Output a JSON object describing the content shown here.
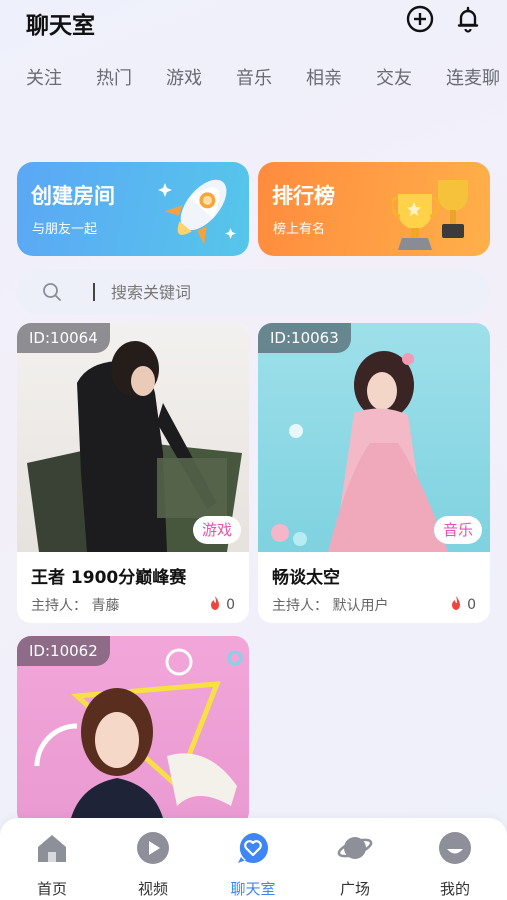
{
  "header": {
    "title": "聊天室"
  },
  "tabs": [
    "关注",
    "热门",
    "游戏",
    "音乐",
    "相亲",
    "交友",
    "连麦聊"
  ],
  "banners": {
    "create": {
      "title": "创建房间",
      "subtitle": "与朋友一起"
    },
    "rank": {
      "title": "排行榜",
      "subtitle": "榜上有名"
    }
  },
  "search": {
    "placeholder": "搜索关键词"
  },
  "rooms": [
    {
      "id": "ID:10064",
      "name": "王者 1900分巅峰赛",
      "host": "主持人：  青藤",
      "heat": "0",
      "category": "游戏"
    },
    {
      "id": "ID:10063",
      "name": "畅谈太空",
      "host": "主持人：  默认用户",
      "heat": "0",
      "category": "音乐"
    },
    {
      "id": "ID:10062"
    }
  ],
  "tabbar": [
    {
      "label": "首页",
      "icon": "home-icon"
    },
    {
      "label": "视频",
      "icon": "video-play-icon"
    },
    {
      "label": "聊天室",
      "icon": "chat-heart-icon",
      "active": true
    },
    {
      "label": "广场",
      "icon": "planet-icon"
    },
    {
      "label": "我的",
      "icon": "profile-icon"
    }
  ],
  "colors": {
    "accent": "#3d86f4",
    "badge_text": "#e94fb6",
    "flame": "#f0453a"
  }
}
